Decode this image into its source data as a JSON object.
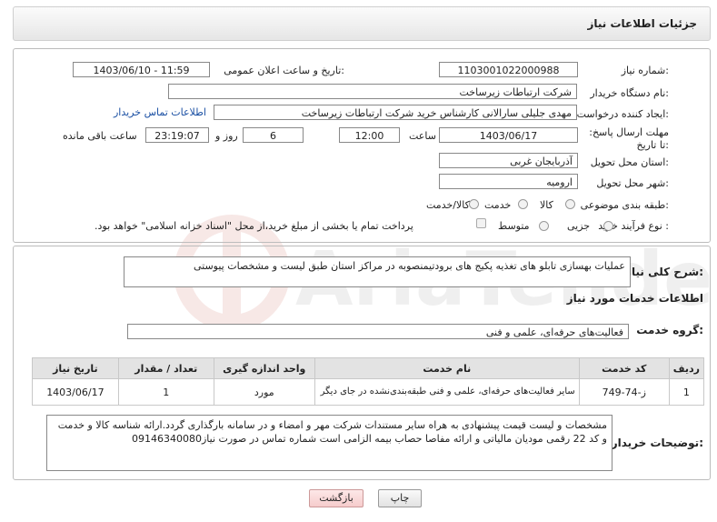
{
  "header": {
    "title": "جزئیات اطلاعات نیاز"
  },
  "need": {
    "number_label": "شماره نیاز:",
    "number": "1103001022000988",
    "announce_label": "تاریخ و ساعت اعلان عمومی:",
    "announce_value": "1403/06/10 - 11:59",
    "buyer_label": "نام دستگاه خریدار:",
    "buyer": "شرکت ارتباطات زیرساخت",
    "creator_label": "ایجاد کننده درخواست:",
    "creator": "مهدی جلیلی سارالانی کارشناس خرید شرکت ارتباطات زیرساخت",
    "contact_link": "اطلاعات تماس خریدار",
    "deadline_label": "مهلت ارسال پاسخ: تا تاریخ:",
    "deadline_date": "1403/06/17",
    "time_label": "ساعت",
    "deadline_time": "12:00",
    "days_value": "6",
    "days_label": "روز و",
    "remaining_time": "23:19:07",
    "remaining_label": "ساعت باقی مانده",
    "province_label": "استان محل تحویل:",
    "province": "آذربایجان غربی",
    "city_label": "شهر محل تحویل:",
    "city": "ارومیه",
    "category_label": "طبقه بندی موضوعی:",
    "category_options": [
      "کالا",
      "خدمت",
      "کالا/خدمت"
    ],
    "process_label": "نوع فرآیند خرید :",
    "process_options": [
      "جزیی",
      "متوسط"
    ],
    "payment_note": "پرداخت تمام یا بخشی از مبلغ خرید،از محل \"اسناد خزانه اسلامی\" خواهد بود."
  },
  "summary": {
    "label": "شرح کلی نیاز:",
    "value": "عملیات بهسازی تابلو های تغذیه پکیج های برودتیمنصوبه در مراکز استان طبق لیست و مشخصات پیوستی"
  },
  "services": {
    "title": "اطلاعات خدمات مورد نیاز",
    "group_label": "گروه خدمت:",
    "group_value": "فعالیت‌های حرفه‌ای، علمی و فنی",
    "columns": [
      "ردیف",
      "کد خدمت",
      "نام خدمت",
      "واحد اندازه گیری",
      "تعداد / مقدار",
      "تاریخ نیاز"
    ],
    "rows": [
      {
        "row": "1",
        "code": "ز-74-749",
        "name": "سایر فعالیت‌های حرفه‌ای، علمی و فنی طبقه‌بندی‌نشده در جای دیگر",
        "unit": "مورد",
        "qty": "1",
        "date": "1403/06/17"
      }
    ]
  },
  "buyer_notes": {
    "label": "توضیحات خریدار:",
    "value": "مشخصات و لیست قیمت پیشنهادی به هراه سایر مستندات شرکت مهر و امضاء و در سامانه بارگذاری گردد.ارائه شناسه کالا و خدمت و کد 22 رقمی مودیان مالیاتی و ارائه مفاصا حصاب بیمه الزامی است شماره تماس در صورت نیاز09146340080"
  },
  "buttons": {
    "print": "چاپ",
    "back": "بازگشت"
  },
  "watermark": {
    "text": "AriaTender.neT"
  },
  "colors": {
    "link": "#1a4fa3",
    "header_bg": "#e6e6e6",
    "table_header": "#e3e3e3",
    "back_button": "#f6cccc"
  }
}
